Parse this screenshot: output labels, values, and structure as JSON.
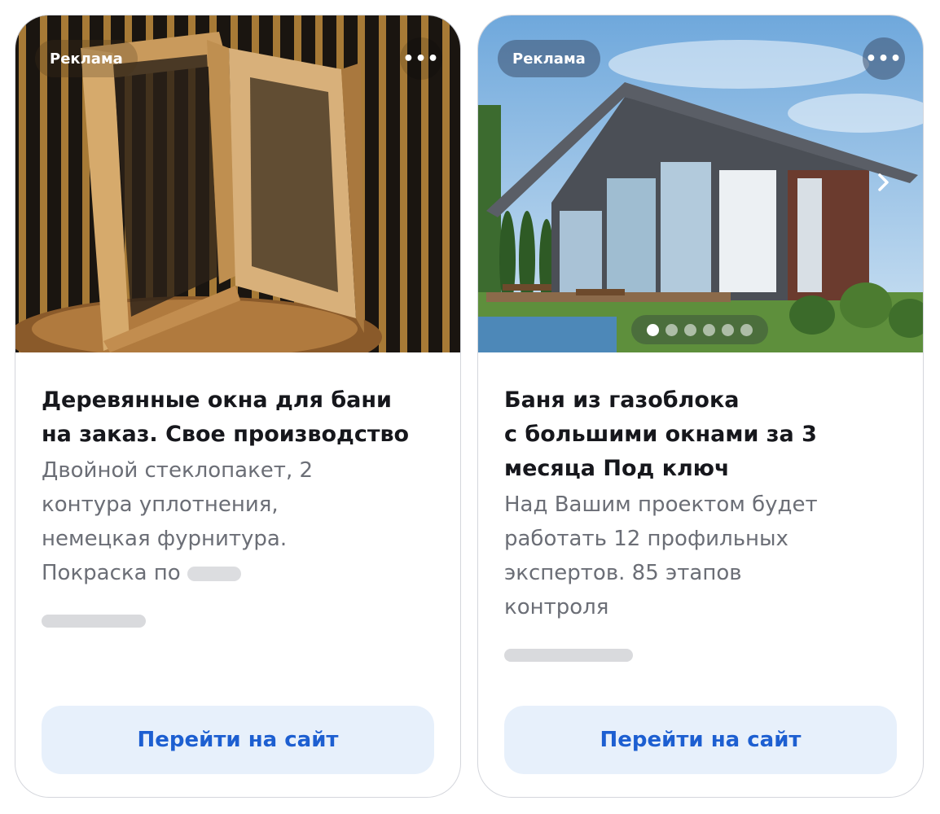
{
  "cards": [
    {
      "ad_label": "Реклама",
      "more_label": "•••",
      "title_lines": [
        "Деревянные окна для бани",
        "на заказ. Свое производство"
      ],
      "desc_lines": [
        "Двойной стеклопакет, 2",
        "контура уплотнения,",
        "немецкая фурнитура.",
        "Покраска по"
      ],
      "cta_label": "Перейти на сайт",
      "image_subject": "wooden-window-frame"
    },
    {
      "ad_label": "Реклама",
      "more_label": "•••",
      "title_lines": [
        "Баня из газоблока",
        "с большими окнами за 3",
        "месяца Под ключ"
      ],
      "desc_lines": [
        "Над Вашим проектом будет",
        "работать 12 профильных",
        "экспертов. 85 этапов",
        "контроля"
      ],
      "cta_label": "Перейти на сайт",
      "image_subject": "house-with-large-windows",
      "carousel": {
        "total": 6,
        "active_index": 0
      }
    }
  ],
  "colors": {
    "cta_bg": "#e7f0fb",
    "cta_text": "#1d5fd1",
    "title_text": "#16171c",
    "desc_text": "#6b6e76"
  }
}
